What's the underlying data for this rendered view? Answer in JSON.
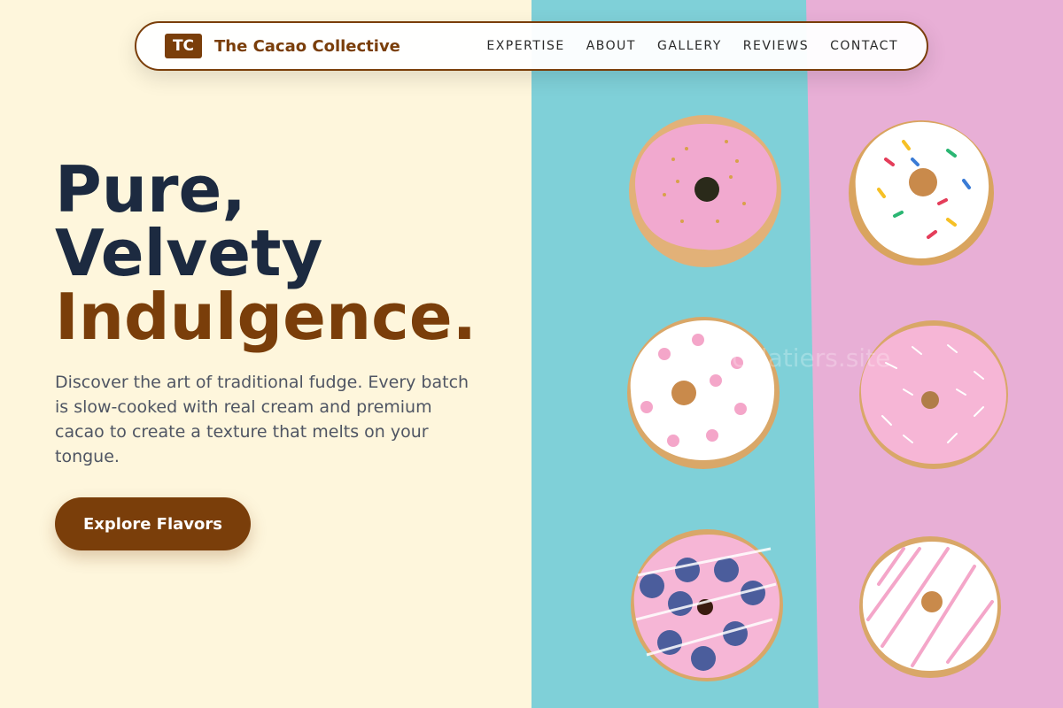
{
  "header": {
    "logo_initials": "TC",
    "brand_name": "The Cacao Collective",
    "nav": [
      "EXPERTISE",
      "ABOUT",
      "GALLERY",
      "REVIEWS",
      "CONTACT"
    ]
  },
  "hero": {
    "title_line1": "Pure,",
    "title_line2": "Velvety",
    "title_line3": "Indulgence.",
    "description": "Discover the art of traditional fudge. Every batch is slow-cooked with real cream and premium cacao to create a texture that melts on your tongue.",
    "cta_label": "Explore Flavors"
  },
  "image": {
    "watermark": "chocolatiers.site",
    "donuts": [
      {
        "frosting": "#f1a9cf",
        "topping": "gold-sprinkles"
      },
      {
        "frosting": "#ffffff",
        "topping": "rainbow-sprinkles"
      },
      {
        "frosting": "#ffffff",
        "topping": "pink-dots"
      },
      {
        "frosting": "#f6b6d6",
        "topping": "coconut-flakes"
      },
      {
        "frosting": "#f6b6d6",
        "topping": "blueberries"
      },
      {
        "frosting": "#ffffff",
        "topping": "pink-drizzle"
      }
    ]
  },
  "colors": {
    "accent": "#7a3e0a",
    "background": "#fef6dc",
    "title_dark": "#1c2a40",
    "teal": "#7fd0d8",
    "pink": "#e8afd6"
  }
}
